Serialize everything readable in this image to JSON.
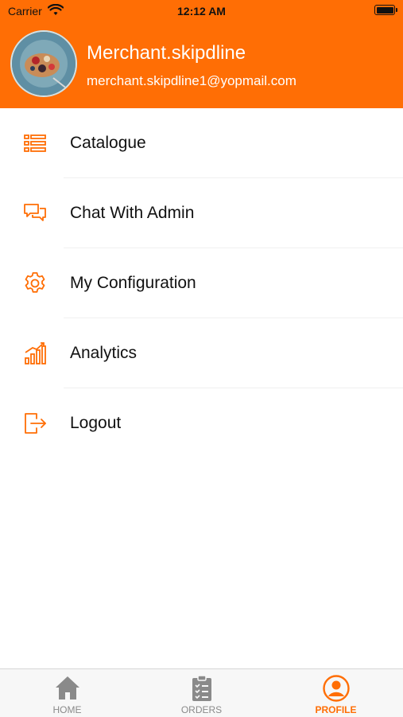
{
  "status_bar": {
    "carrier": "Carrier",
    "time": "12:12 AM"
  },
  "profile": {
    "name": "Merchant.skipdline",
    "email": "merchant.skipdline1@yopmail.com"
  },
  "menu": {
    "items": [
      {
        "label": "Catalogue",
        "icon": "list-icon"
      },
      {
        "label": "Chat With Admin",
        "icon": "chat-icon"
      },
      {
        "label": "My Configuration",
        "icon": "gear-icon"
      },
      {
        "label": "Analytics",
        "icon": "analytics-icon"
      },
      {
        "label": "Logout",
        "icon": "logout-icon"
      }
    ]
  },
  "tabbar": {
    "tabs": [
      {
        "label": "HOME",
        "icon": "home-icon",
        "active": false
      },
      {
        "label": "ORDERS",
        "icon": "clipboard-icon",
        "active": false
      },
      {
        "label": "PROFILE",
        "icon": "user-icon",
        "active": true
      }
    ]
  },
  "colors": {
    "accent": "#ff6e05",
    "inactive": "#8a8a8a"
  }
}
